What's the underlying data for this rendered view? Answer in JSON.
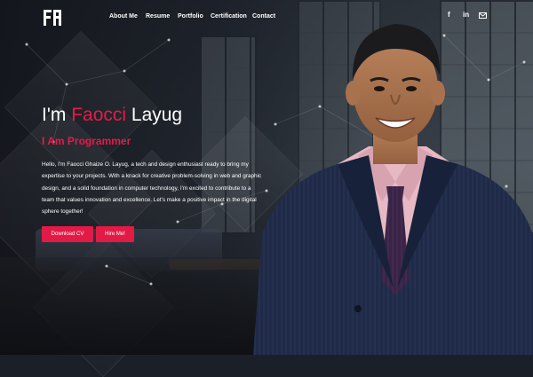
{
  "nav": {
    "items": [
      "About Me",
      "Resume",
      "Portfolio",
      "Certification",
      "Contact"
    ]
  },
  "social": {
    "facebook": "f",
    "linkedin": "in",
    "email_icon": "email-icon"
  },
  "hero": {
    "greeting": "I'm",
    "first_name": "Faocci",
    "last_name": "Layug",
    "role": "I Am Programmer",
    "description": "Hello, I'm Faocci Ghaize O. Layug, a tech and design enthusiast ready to bring my expertise to your projects. With a knack for creative problem-solving in web and graphic design, and a solid foundation in computer technology, I'm excited to contribute to a team that values innovation and excellence. Let's make a positive impact in the digital sphere together!",
    "download_label": "Download CV",
    "hire_label": "Hire Me!"
  },
  "colors": {
    "accent": "#e21a46",
    "text": "#ffffff",
    "background": "#1b2028"
  }
}
